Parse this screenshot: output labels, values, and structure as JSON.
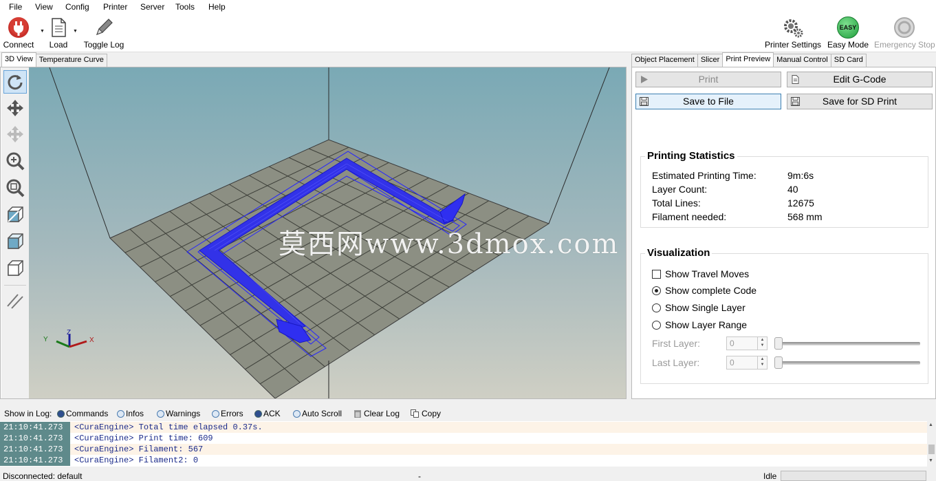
{
  "menu": [
    "File",
    "View",
    "Config",
    "Printer",
    "Server",
    "Tools",
    "Help"
  ],
  "toolbar": {
    "connect": "Connect",
    "load": "Load",
    "toggle_log": "Toggle Log",
    "printer_settings": "Printer Settings",
    "easy_mode": "Easy Mode",
    "easy_badge": "EASY",
    "emergency_stop": "Emergency Stop"
  },
  "left_tabs": [
    "3D View",
    "Temperature Curve"
  ],
  "left_tools": [
    "rotate-icon",
    "move-icon",
    "move-object-icon",
    "zoom-icon",
    "fit-view-icon",
    "isometric-view-icon",
    "front-view-icon",
    "top-view-icon",
    "parallel-projection-icon"
  ],
  "axes": {
    "x": "X",
    "y": "Y",
    "z": "Z"
  },
  "right_tabs": [
    "Object Placement",
    "Slicer",
    "Print Preview",
    "Manual Control",
    "SD Card"
  ],
  "actions": {
    "print": "Print",
    "edit_gcode": "Edit G-Code",
    "save_to_file": "Save to File",
    "save_sd": "Save for SD Print"
  },
  "stats": {
    "title": "Printing Statistics",
    "rows": [
      {
        "label": "Estimated Printing Time:",
        "value": "9m:6s"
      },
      {
        "label": "Layer Count:",
        "value": "40"
      },
      {
        "label": "Total Lines:",
        "value": "12675"
      },
      {
        "label": "Filament needed:",
        "value": "568 mm"
      }
    ]
  },
  "visualization": {
    "title": "Visualization",
    "show_travel": "Show Travel Moves",
    "show_travel_checked": false,
    "options": [
      "Show complete Code",
      "Show Single Layer",
      "Show Layer Range"
    ],
    "selected": "Show complete Code",
    "first_layer_label": "First Layer:",
    "first_layer_value": "0",
    "last_layer_label": "Last Layer:",
    "last_layer_value": "0"
  },
  "logbar": {
    "show_in_log": "Show in Log:",
    "commands": "Commands",
    "infos": "Infos",
    "warnings": "Warnings",
    "errors": "Errors",
    "ack": "ACK",
    "auto_scroll": "Auto Scroll",
    "clear_log": "Clear Log",
    "copy": "Copy"
  },
  "log": [
    {
      "time": "21:10:41.273",
      "msg": "<CuraEngine> Total time elapsed  0.37s."
    },
    {
      "time": "21:10:41.273",
      "msg": "<CuraEngine> Print time: 609"
    },
    {
      "time": "21:10:41.273",
      "msg": "<CuraEngine> Filament: 567"
    },
    {
      "time": "21:10:41.273",
      "msg": "<CuraEngine> Filament2: 0"
    }
  ],
  "status": {
    "connection": "Disconnected: default",
    "middle": "-",
    "state": "Idle"
  },
  "watermark": "莫西网www.3dmox.com",
  "colors": {
    "accent": "#3c7fb1",
    "model": "#2a2af0",
    "log_time_bg": "#5f8a8b",
    "easy": "#22b14c"
  }
}
